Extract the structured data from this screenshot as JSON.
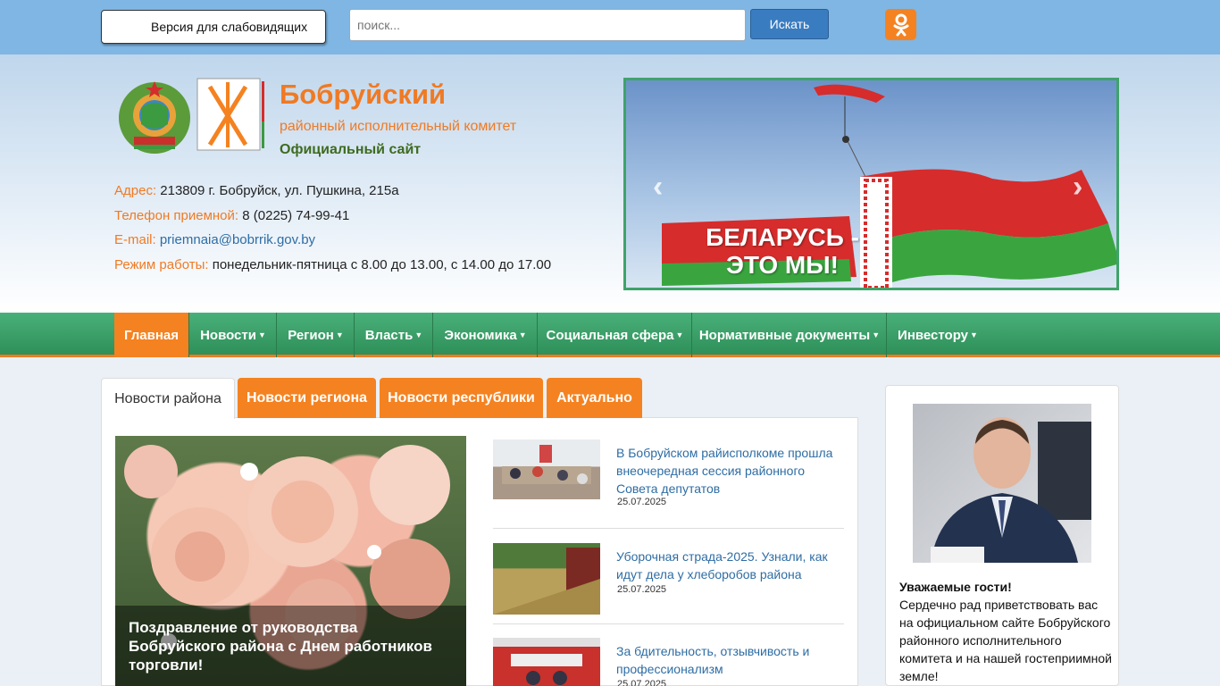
{
  "topbar": {
    "vision_label": "Версия для слабовидящих",
    "search_placeholder": "поиск...",
    "search_button": "Искать"
  },
  "header": {
    "title": "Бобруйский",
    "subtitle": "районный исполнительный комитет",
    "site_label": "Официальный сайт",
    "address_label": "Адрес:",
    "address_value": "213809 г. Бобруйск, ул. Пушкина, 215а",
    "phone_label": "Телефон приемной:",
    "phone_value": "8 (0225) 74-99-41",
    "email_label": "E-mail:",
    "email_value": "priemnaia@bobrrik.gov.by",
    "hours_label": "Режим работы:",
    "hours_value": "понедельник-пятница с 8.00 до 13.00, с 14.00 до 17.00"
  },
  "banner": {
    "line1": "БЕЛАРУСЬ -",
    "line2": "ЭТО МЫ!"
  },
  "nav": [
    {
      "label": "Главная"
    },
    {
      "label": "Новости"
    },
    {
      "label": "Регион"
    },
    {
      "label": "Власть"
    },
    {
      "label": "Экономика"
    },
    {
      "label": "Социальная сфера"
    },
    {
      "label": "Нормативные документы"
    },
    {
      "label": "Инвестору"
    }
  ],
  "tabs": [
    {
      "label": "Новости района"
    },
    {
      "label": "Новости региона"
    },
    {
      "label": "Новости республики"
    },
    {
      "label": "Актуально"
    }
  ],
  "feature": {
    "caption": "Поздравление от руководства Бобруйского района с Днем работников торговли!"
  },
  "news": [
    {
      "title": "В Бобруйском райисполкоме прошла внеочередная сессия районного Совета депутатов",
      "date": "25.07.2025"
    },
    {
      "title": "Уборочная страда-2025. Узнали, как идут дела у хлеборобов района",
      "date": "25.07.2025"
    },
    {
      "title": "За бдительность, отзывчивость и профессионализм",
      "date": "25.07.2025"
    }
  ],
  "sidebar": {
    "greeting_title": "Уважаемые гости!",
    "greeting_text": "Сердечно рад приветствовать вас на официальном сайте Бобруйского районного исполнительного комитета и на нашей гостеприимной земле!"
  },
  "colors": {
    "accent": "#f58220",
    "nav_green": "#2f8f58",
    "link": "#2e6da4",
    "topbar": "#7fb6e3"
  }
}
